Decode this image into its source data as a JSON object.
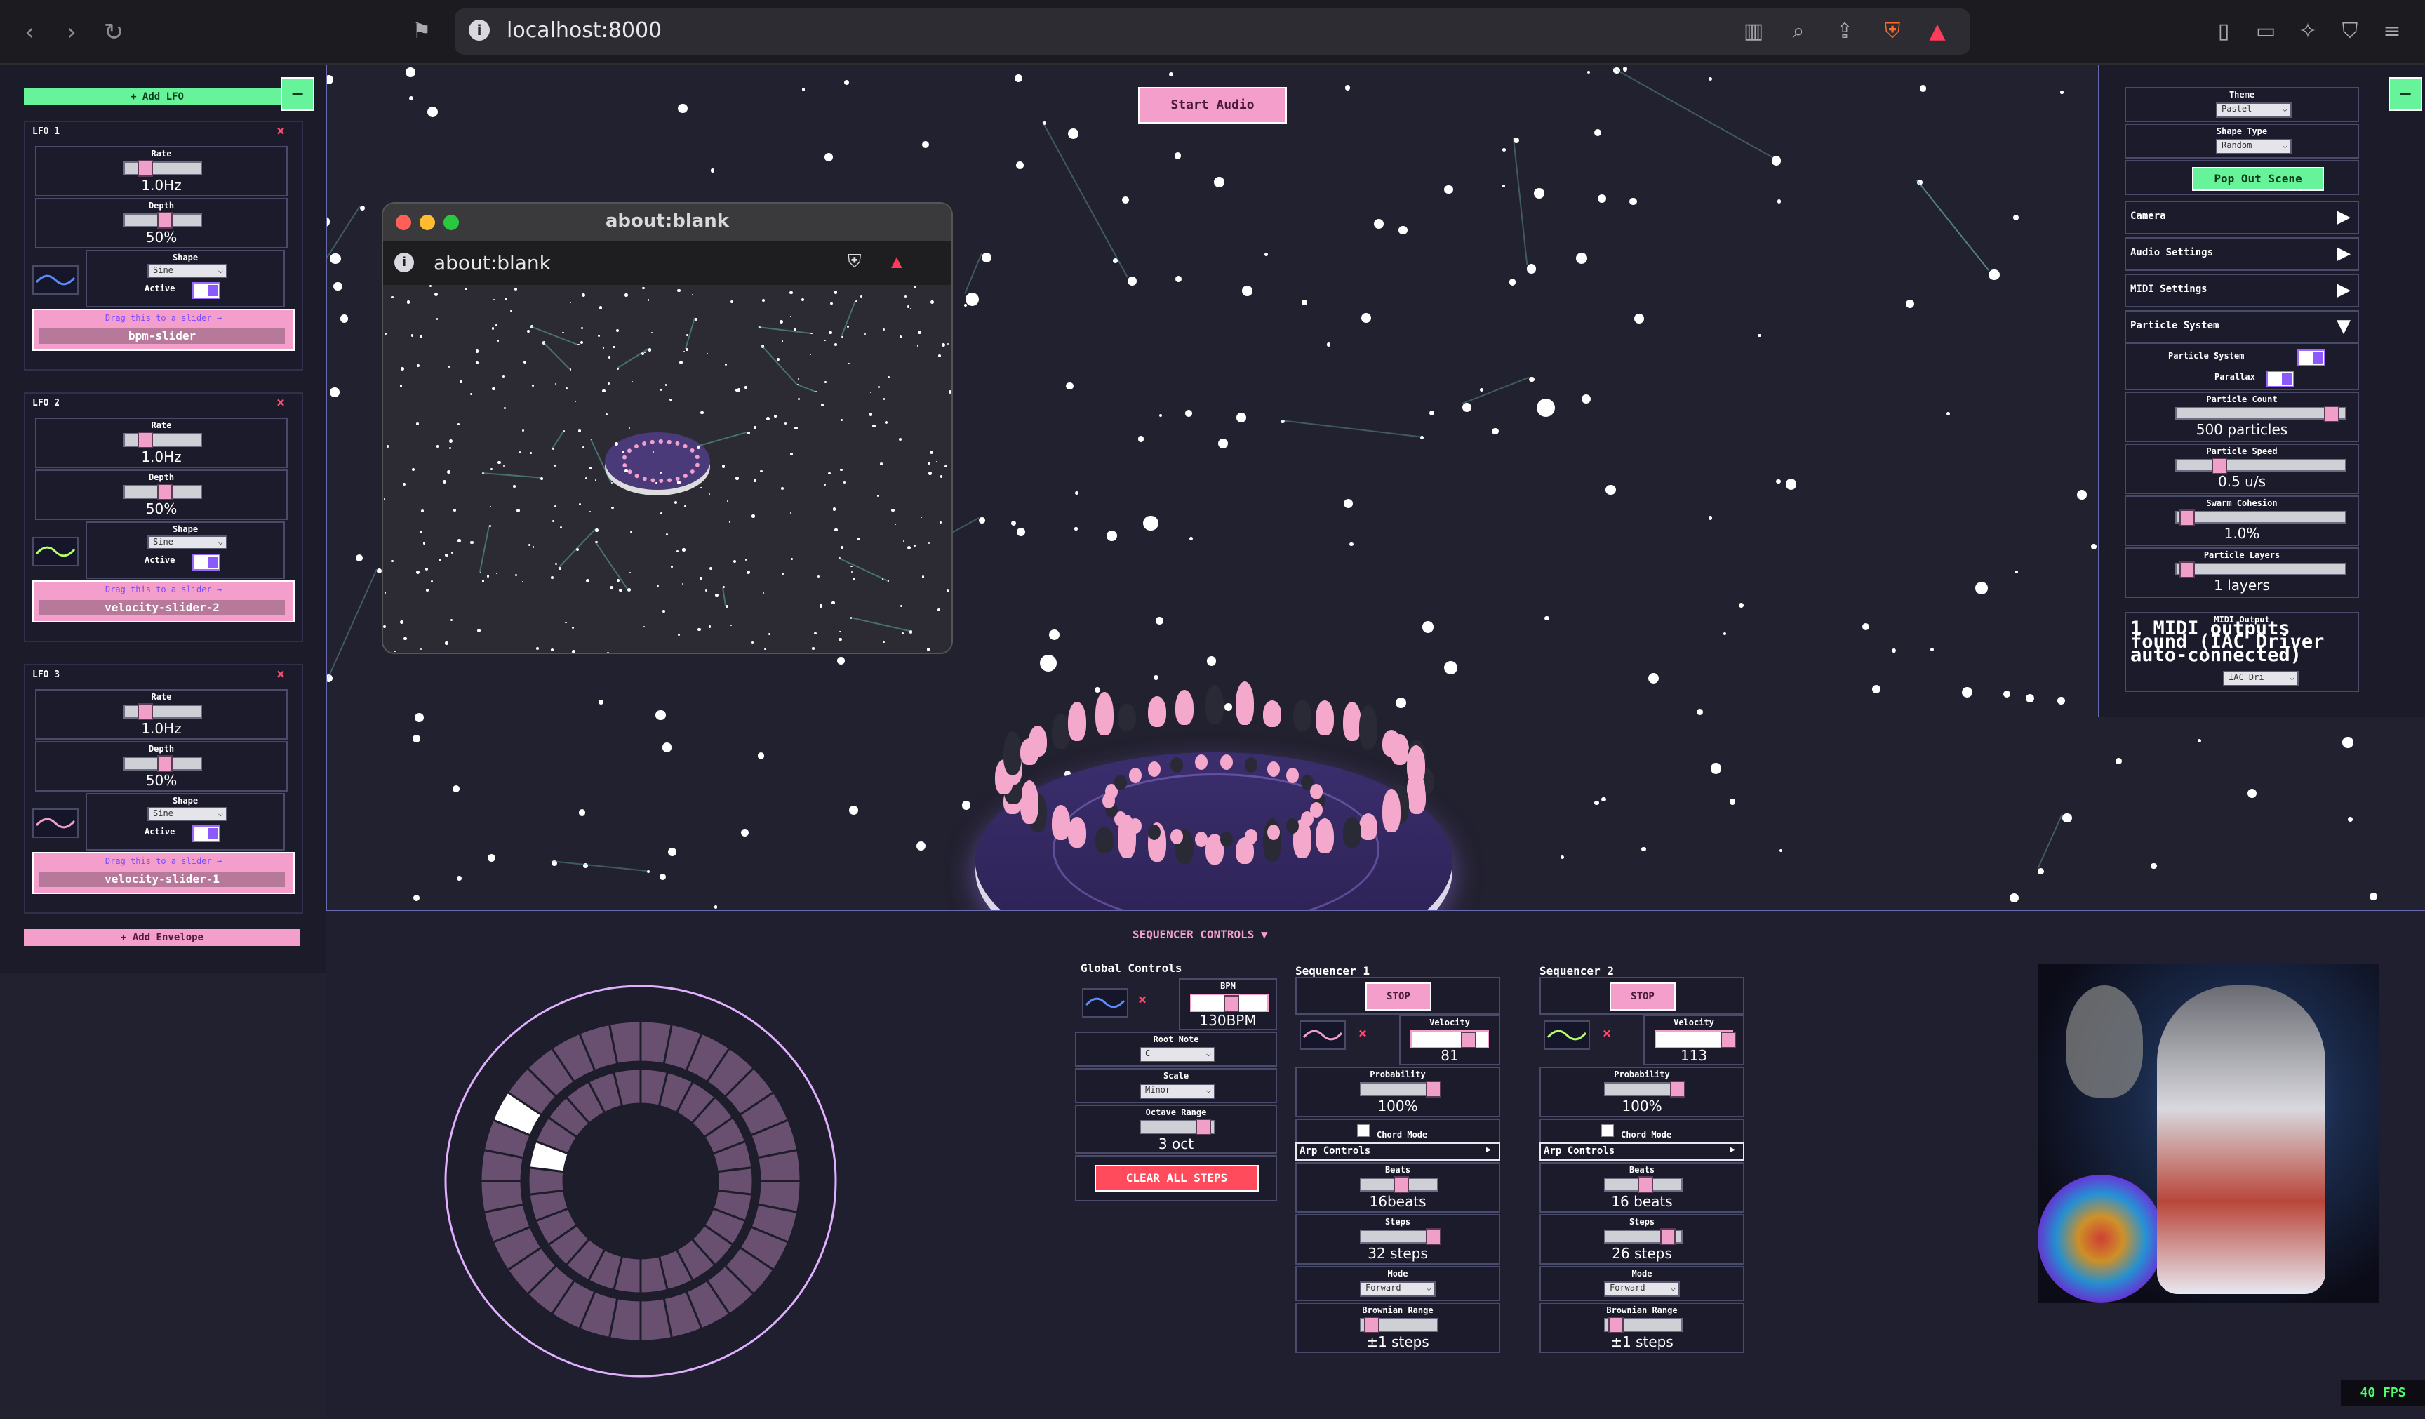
{
  "browser": {
    "url": "localhost:8000",
    "popup_title": "about:blank",
    "popup_url": "about:blank"
  },
  "header": {
    "start_audio": "Start Audio"
  },
  "lfo_panel": {
    "add_lfo": "+ Add LFO",
    "collapse": "−",
    "lfos": [
      {
        "title": "LFO 1",
        "rate_label": "Rate",
        "rate": "1.0Hz",
        "depth_label": "Depth",
        "depth": "50%",
        "shape_label": "Shape",
        "shape": "Sine",
        "active_label": "Active",
        "drag_hint": "Drag this to a slider →",
        "target": "bpm-slider",
        "wave_color": "#5b8cff"
      },
      {
        "title": "LFO 2",
        "rate_label": "Rate",
        "rate": "1.0Hz",
        "depth_label": "Depth",
        "depth": "50%",
        "shape_label": "Shape",
        "shape": "Sine",
        "active_label": "Active",
        "drag_hint": "Drag this to a slider →",
        "target": "velocity-slider-2",
        "wave_color": "#b6ff6b"
      },
      {
        "title": "LFO 3",
        "rate_label": "Rate",
        "rate": "1.0Hz",
        "depth_label": "Depth",
        "depth": "50%",
        "shape_label": "Shape",
        "shape": "Sine",
        "active_label": "Active",
        "drag_hint": "Drag this to a slider →",
        "target": "velocity-slider-1",
        "wave_color": "#f49fcb"
      }
    ],
    "add_envelope": "+ Add Envelope"
  },
  "settings_panel": {
    "theme_label": "Theme",
    "theme": "Pastel",
    "shape_type_label": "Shape Type",
    "shape_type": "Random",
    "pop_out": "Pop Out Scene",
    "sections": [
      {
        "label": "Camera",
        "arrow": "▶"
      },
      {
        "label": "Audio Settings",
        "arrow": "▶"
      },
      {
        "label": "MIDI Settings",
        "arrow": "▶"
      },
      {
        "label": "Particle System",
        "arrow": "▼"
      }
    ],
    "particle_system_label": "Particle System",
    "parallax_label": "Parallax",
    "particle_count_label": "Particle Count",
    "particle_count": "500 particles",
    "particle_speed_label": "Particle Speed",
    "particle_speed": "0.5 u/s",
    "swarm_cohesion_label": "Swarm Cohesion",
    "swarm_cohesion": "1.0%",
    "particle_layers_label": "Particle Layers",
    "particle_layers": "1 layers",
    "midi_output_label": "MIDI Output",
    "midi_status": "1 MIDI outputs found (IAC Driver auto-connected)",
    "midi_device": "IAC Dri"
  },
  "sequencer": {
    "toggle_label": "SEQUENCER CONTROLS ▼",
    "seq": [
      {
        "title": "Sequencer 1",
        "stop": "STOP",
        "velocity_label": "Velocity",
        "velocity": "81",
        "probability_label": "Probability",
        "probability": "100%",
        "chord_label": "Chord Mode",
        "arp_label": "Arp Controls",
        "beats_label": "Beats",
        "beats": "16beats",
        "steps_label": "Steps",
        "steps": "32 steps",
        "mode_label": "Mode",
        "mode": "Forward",
        "brownian_label": "Brownian Range",
        "brownian": "±1 steps",
        "wave_color": "#f49fcb"
      },
      {
        "title": "Sequencer 2",
        "stop": "STOP",
        "velocity_label": "Velocity",
        "velocity": "113",
        "probability_label": "Probability",
        "probability": "100%",
        "chord_label": "Chord Mode",
        "arp_label": "Arp Controls",
        "beats_label": "Beats",
        "beats": "16 beats",
        "steps_label": "Steps",
        "steps": "26 steps",
        "mode_label": "Mode",
        "mode": "Forward",
        "brownian_label": "Brownian Range",
        "brownian": "±1 steps",
        "wave_color": "#b6ff6b"
      }
    ],
    "global": {
      "title": "Global Controls",
      "bpm_label": "BPM",
      "bpm": "130BPM",
      "root_label": "Root Note",
      "root": "C",
      "scale_label": "Scale",
      "scale": "Minor",
      "octave_label": "Octave Range",
      "octave": "3 oct",
      "clear": "CLEAR ALL STEPS"
    }
  },
  "fps": "40 FPS"
}
